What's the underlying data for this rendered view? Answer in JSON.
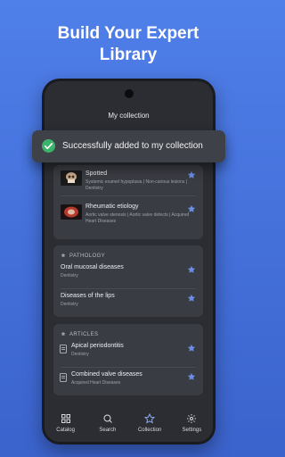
{
  "headline": {
    "line1": "Build Your Expert",
    "line2": "Library"
  },
  "screen_title": "My collection",
  "toast": {
    "message": "Successfully added to my collection"
  },
  "top_items": [
    {
      "title": "Spotted",
      "subtitle": "Systemic enamel hypoplasia | Non-carious lesions | Dentistry"
    },
    {
      "title": "Rheumatic etiology",
      "subtitle": "Aortic valve stenosis | Aortic valve defects | Acquired Heart Diseases"
    }
  ],
  "pathology": {
    "title": "PATHOLOGY",
    "items": [
      {
        "title": "Oral mucosal diseases",
        "subtitle": "Dentistry"
      },
      {
        "title": "Diseases of the lips",
        "subtitle": "Dentistry"
      }
    ]
  },
  "articles": {
    "title": "ARTICLES",
    "items": [
      {
        "title": "Apical periodontitis",
        "subtitle": "Dentistry"
      },
      {
        "title": "Combined valve diseases",
        "subtitle": "Acquired Heart Diseases"
      }
    ]
  },
  "tabs": [
    "Catalog",
    "Search",
    "Collection",
    "Settings"
  ],
  "colors": {
    "background": "#4a78e3",
    "accent_star": "#6a8fe6",
    "success": "#3bb36a",
    "card": "#3a3c43",
    "screen": "#2b2d33"
  }
}
